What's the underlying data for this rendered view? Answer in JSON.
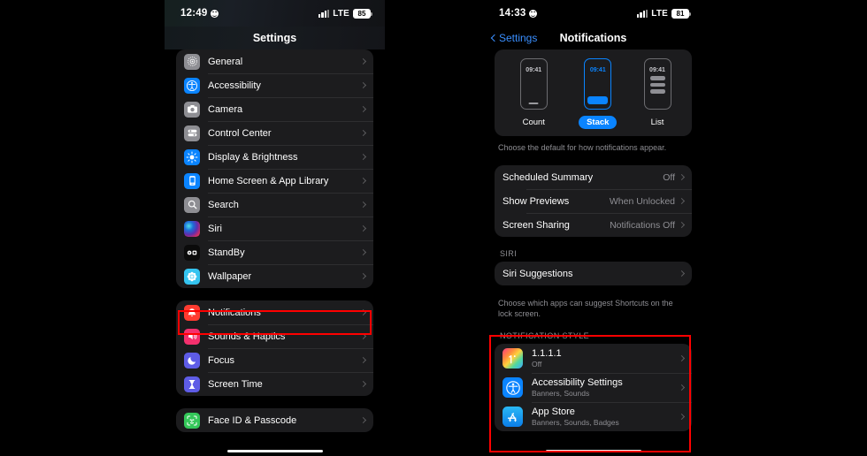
{
  "left_phone": {
    "status": {
      "time": "12:49",
      "network": "LTE",
      "battery": "85",
      "face_icon": "smiley-face-icon",
      "signal_icon": "cellular-bars-icon"
    },
    "nav": {
      "title": "Settings"
    },
    "groups": [
      {
        "id": "group-system",
        "rows": [
          {
            "label": "General",
            "icon": "gear-icon",
            "icon_color": "#8e8e93"
          },
          {
            "label": "Accessibility",
            "icon": "accessibility-icon",
            "icon_color": "#0a84ff"
          },
          {
            "label": "Camera",
            "icon": "camera-icon",
            "icon_color": "#8e8e93"
          },
          {
            "label": "Control Center",
            "icon": "control-center-icon",
            "icon_color": "#8e8e93"
          },
          {
            "label": "Display & Brightness",
            "icon": "brightness-icon",
            "icon_color": "#0a84ff"
          },
          {
            "label": "Home Screen & App Library",
            "icon": "home-screen-icon",
            "icon_color": "#0a84ff"
          },
          {
            "label": "Search",
            "icon": "search-icon",
            "icon_color": "#8e8e93"
          },
          {
            "label": "Siri",
            "icon": "siri-orb-icon",
            "icon_color": "gradient"
          },
          {
            "label": "StandBy",
            "icon": "standby-icon",
            "icon_color": "#0b0b0b"
          },
          {
            "label": "Wallpaper",
            "icon": "wallpaper-icon",
            "icon_color": "#35c4f0"
          }
        ]
      },
      {
        "id": "group-notifications",
        "rows": [
          {
            "label": "Notifications",
            "icon": "bell-icon",
            "icon_color": "#ff3b30"
          },
          {
            "label": "Sounds & Haptics",
            "icon": "speaker-icon",
            "icon_color": "#f4306d"
          },
          {
            "label": "Focus",
            "icon": "moon-icon",
            "icon_color": "#5e5ce6"
          },
          {
            "label": "Screen Time",
            "icon": "hourglass-icon",
            "icon_color": "#5e5ce6"
          }
        ]
      },
      {
        "id": "group-security",
        "rows": [
          {
            "label": "Face ID & Passcode",
            "icon": "face-id-icon",
            "icon_color": "#34c759"
          }
        ]
      }
    ]
  },
  "right_phone": {
    "status": {
      "time": "14:33",
      "network": "LTE",
      "battery": "81",
      "face_icon": "smiley-face-icon",
      "signal_icon": "cellular-bars-icon"
    },
    "nav": {
      "back_label": "Settings",
      "title": "Notifications",
      "back_icon": "chevron-left-icon"
    },
    "display_styles": {
      "options": [
        {
          "name": "Count",
          "mock_time": "09:41",
          "selected": false
        },
        {
          "name": "Stack",
          "mock_time": "09:41",
          "selected": true
        },
        {
          "name": "List",
          "mock_time": "09:41",
          "selected": false
        }
      ],
      "footnote": "Choose the default for how notifications appear."
    },
    "settings_rows": [
      {
        "label": "Scheduled Summary",
        "value": "Off"
      },
      {
        "label": "Show Previews",
        "value": "When Unlocked"
      },
      {
        "label": "Screen Sharing",
        "value": "Notifications Off"
      }
    ],
    "siri_section": {
      "header": "SIRI",
      "row_label": "Siri Suggestions",
      "footnote": "Choose which apps can suggest Shortcuts on the lock screen."
    },
    "notification_style": {
      "header": "NOTIFICATION STYLE",
      "apps": [
        {
          "name": "1.1.1.1",
          "sub": "Off",
          "icon": "cloudflare-warp-icon"
        },
        {
          "name": "Accessibility Settings",
          "sub": "Banners, Sounds",
          "icon": "accessibility-icon"
        },
        {
          "name": "App Store",
          "sub": "Banners, Sounds, Badges",
          "icon": "app-store-icon"
        }
      ]
    }
  },
  "highlights": {
    "accent_color": "#ff0000",
    "boxes": [
      {
        "id": "hl-notifications",
        "target": "Notifications"
      },
      {
        "id": "hl-notification-style",
        "target": "NOTIFICATION STYLE"
      }
    ]
  }
}
